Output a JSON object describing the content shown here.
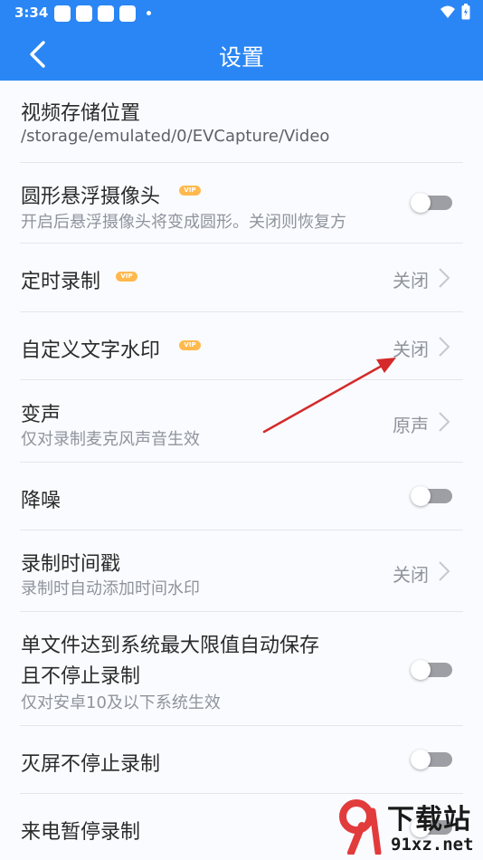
{
  "status_bar": {
    "time": "3:34"
  },
  "app_bar": {
    "title": "设置"
  },
  "settings": {
    "storage": {
      "label": "视频存储位置",
      "path": "/storage/emulated/0/EVCapture/Video"
    },
    "round_camera": {
      "label": "圆形悬浮摄像头",
      "vip": "VIP",
      "desc": "开启后悬浮摄像头将变成圆形。关闭则恢复方",
      "enabled": false
    },
    "timed_record": {
      "label": "定时录制",
      "vip": "VIP",
      "value": "关闭"
    },
    "custom_watermark": {
      "label": "自定义文字水印",
      "vip": "VIP",
      "value": "关闭"
    },
    "voice_change": {
      "label": "变声",
      "desc": "仅对录制麦克风声音生效",
      "value": "原声"
    },
    "noise_reduction": {
      "label": "降噪",
      "enabled": false
    },
    "timestamp": {
      "label": "录制时间戳",
      "desc": "录制时自动添加时间水印",
      "value": "关闭"
    },
    "auto_save": {
      "label_line1": "单文件达到系统最大限值自动保存",
      "label_line2": "且不停止录制",
      "desc": "仅对安卓10及以下系统生效",
      "enabled": false
    },
    "screen_off": {
      "label": "灭屏不停止录制",
      "enabled": false
    },
    "call_pause": {
      "label": "来电暂停录制"
    }
  },
  "watermark": {
    "brand": "下载站",
    "domain": "91xz.net"
  },
  "colors": {
    "primary": "#2a86f4",
    "vip": "#ffb94d",
    "annotation_arrow": "#d42a2a"
  }
}
